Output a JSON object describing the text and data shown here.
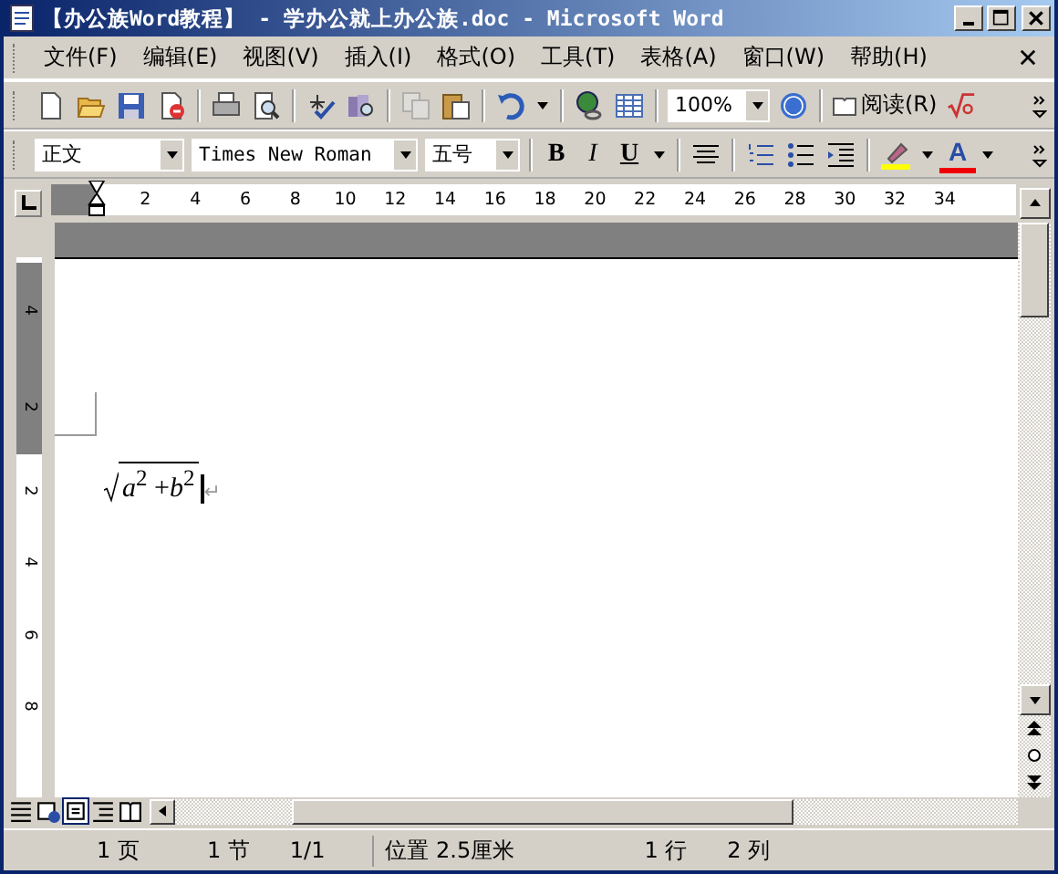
{
  "window": {
    "title": "【办公族Word教程】 - 学办公就上办公族.doc - Microsoft Word"
  },
  "menu": [
    "文件(F)",
    "编辑(E)",
    "视图(V)",
    "插入(I)",
    "格式(O)",
    "工具(T)",
    "表格(A)",
    "窗口(W)",
    "帮助(H)"
  ],
  "standard_toolbar": {
    "zoom": "100%",
    "read_button": "阅读(R)",
    "copy_disabled": true
  },
  "formatting_toolbar": {
    "style": "正文",
    "font": "Times New Roman",
    "size": "五号",
    "bold": "B",
    "italic": "I",
    "underline": "U",
    "font_color": "A"
  },
  "ruler": {
    "numbers": [
      "2",
      "4",
      "6",
      "8",
      "10",
      "12",
      "14",
      "16",
      "18",
      "20",
      "22",
      "24",
      "26",
      "28",
      "30",
      "32",
      "34"
    ]
  },
  "vertical_ruler": {
    "top_numbers": [
      "4",
      "2"
    ],
    "numbers": [
      "2",
      "4",
      "6",
      "8"
    ]
  },
  "document": {
    "equation": "*a*$^{2}$ +*b*$^{2}$",
    "paragraph_mark": "↵"
  },
  "status_bar": [
    "1 页",
    "1 节",
    "1/1",
    "位置 2.5厘米",
    "1 行",
    "2 列"
  ]
}
